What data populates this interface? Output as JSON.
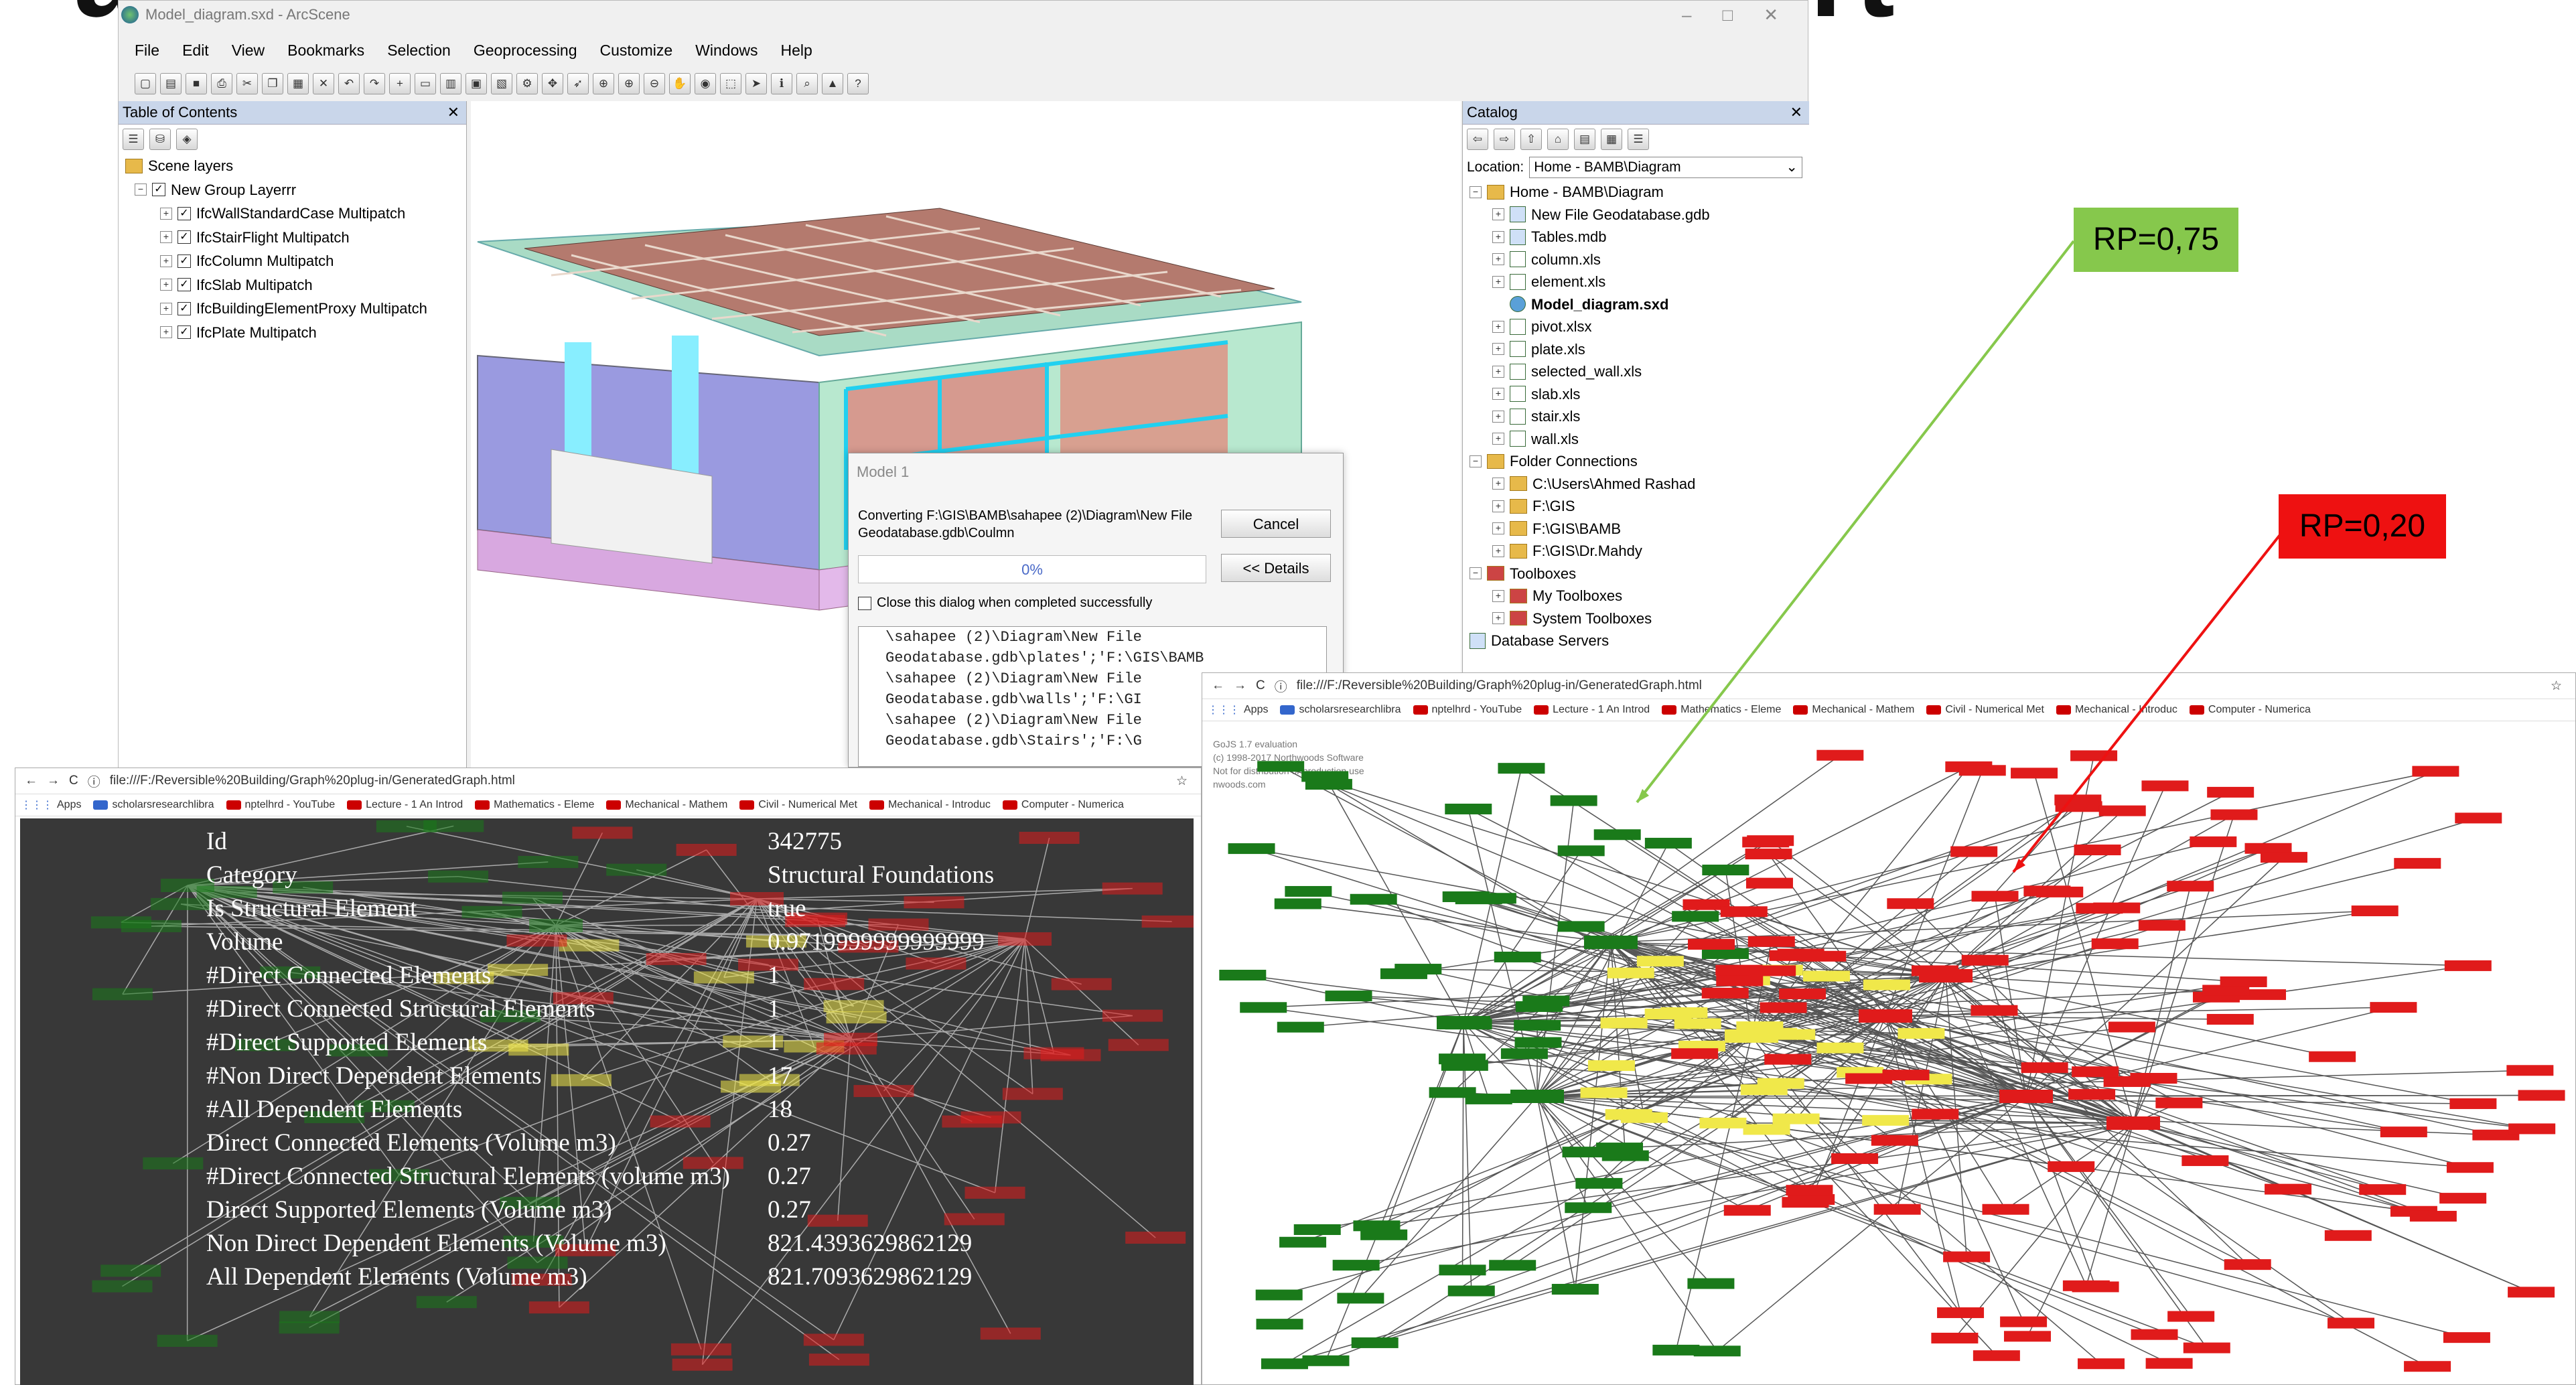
{
  "slide": {
    "title": "and reversible building passport"
  },
  "colors": {
    "green_node": "#1a7a1a",
    "red_node": "#e01b1b",
    "yellow_node": "#f0e84a",
    "callout_green": "#86c84c",
    "callout_red": "#ee1111"
  },
  "arcscene": {
    "title": "Model_diagram.sxd - ArcScene",
    "menu": [
      "File",
      "Edit",
      "View",
      "Bookmarks",
      "Selection",
      "Geoprocessing",
      "Customize",
      "Windows",
      "Help"
    ],
    "toc": {
      "title": "Table of Contents",
      "root": "Scene layers",
      "group": "New Group Layerrr",
      "layers": [
        "IfcWallStandardCase Multipatch",
        "IfcStairFlight Multipatch",
        "IfcColumn Multipatch",
        "IfcSlab Multipatch",
        "IfcBuildingElementProxy Multipatch",
        "IfcPlate Multipatch"
      ]
    },
    "catalog": {
      "title": "Catalog",
      "location_label": "Location:",
      "location_value": "Home - BAMB\\Diagram",
      "home": "Home - BAMB\\Diagram",
      "items": [
        "New File Geodatabase.gdb",
        "Tables.mdb",
        "column.xls",
        "element.xls",
        "Model_diagram.sxd",
        "pivot.xlsx",
        "plate.xls",
        "selected_wall.xls",
        "slab.xls",
        "stair.xls",
        "wall.xls"
      ],
      "folder_connections": "Folder Connections",
      "folders": [
        "C:\\Users\\Ahmed Rashad",
        "F:\\GIS",
        "F:\\GIS\\BAMB",
        "F:\\GIS\\Dr.Mahdy"
      ],
      "toolboxes": "Toolboxes",
      "toolbox_items": [
        "My Toolboxes",
        "System Toolboxes"
      ],
      "database_servers": "Database Servers"
    },
    "dialog": {
      "title": "Model 1",
      "message": "Converting F:\\GIS\\BAMB\\sahapee (2)\\Diagram\\New File Geodatabase.gdb\\Coulmn",
      "progress": "0%",
      "cancel": "Cancel",
      "details": "<< Details",
      "close_label": "Close this dialog when completed successfully",
      "log": [
        "\\sahapee (2)\\Diagram\\New File",
        "Geodatabase.gdb\\plates';'F:\\GIS\\BAMB",
        "\\sahapee (2)\\Diagram\\New File",
        "Geodatabase.gdb\\walls';'F:\\GI",
        "\\sahapee (2)\\Diagram\\New File",
        "Geodatabase.gdb\\Stairs';'F:\\G"
      ]
    }
  },
  "browser_left": {
    "url": "file:///F:/Reversible%20Building/Graph%20plug-in/GeneratedGraph.html",
    "bookmarks": [
      "Apps",
      "scholarsresearchlibra",
      "nptelhrd - YouTube",
      "Lecture - 1 An Introd",
      "Mathematics - Eleme",
      "Mechanical - Mathem",
      "Civil - Numerical Met",
      "Mechanical - Introduc",
      "Computer - Numerica"
    ]
  },
  "info": {
    "rows": [
      {
        "key": "Id",
        "value": "342775"
      },
      {
        "key": "Category",
        "value": "Structural Foundations"
      },
      {
        "key": "Is Structural Element",
        "value": "true"
      },
      {
        "key": "Volume",
        "value": "0.9719999999999999"
      },
      {
        "key": "#Direct Connected Elements",
        "value": "1"
      },
      {
        "key": "#Direct Connected Structural Elements",
        "value": "1"
      },
      {
        "key": "#Direct Supported Elements",
        "value": "1"
      },
      {
        "key": "#Non Direct Dependent Elements",
        "value": "17"
      },
      {
        "key": "#All Dependent Elements",
        "value": "18"
      },
      {
        "key": "Direct Connected Elements (Volume m3)",
        "value": "0.27"
      },
      {
        "key": "#Direct Connected Structural Elements (volume m3)",
        "value": "0.27"
      },
      {
        "key": "Direct Supported Elements (Volume m3)",
        "value": "0.27"
      },
      {
        "key": "Non Direct Dependent Elements (Volume m3)",
        "value": "821.4393629862129"
      },
      {
        "key": "All Dependent Elements (Volume m3)",
        "value": "821.7093629862129"
      }
    ]
  },
  "browser_right": {
    "url": "file:///F:/Reversible%20Building/Graph%20plug-in/GeneratedGraph.html",
    "bookmarks": [
      "Apps",
      "scholarsresearchlibra",
      "nptelhrd - YouTube",
      "Lecture - 1 An Introd",
      "Mathematics - Eleme",
      "Mechanical - Mathem",
      "Civil - Numerical Met",
      "Mechanical - Introduc",
      "Computer - Numerica"
    ],
    "watermark": [
      "GoJS 1.7 evaluation",
      "(c) 1998-2017 Northwoods Software",
      "Not for distribution or production use",
      "nwoods.com"
    ]
  },
  "callouts": {
    "rp_green": "RP=0,75",
    "rp_red": "RP=0,20"
  }
}
